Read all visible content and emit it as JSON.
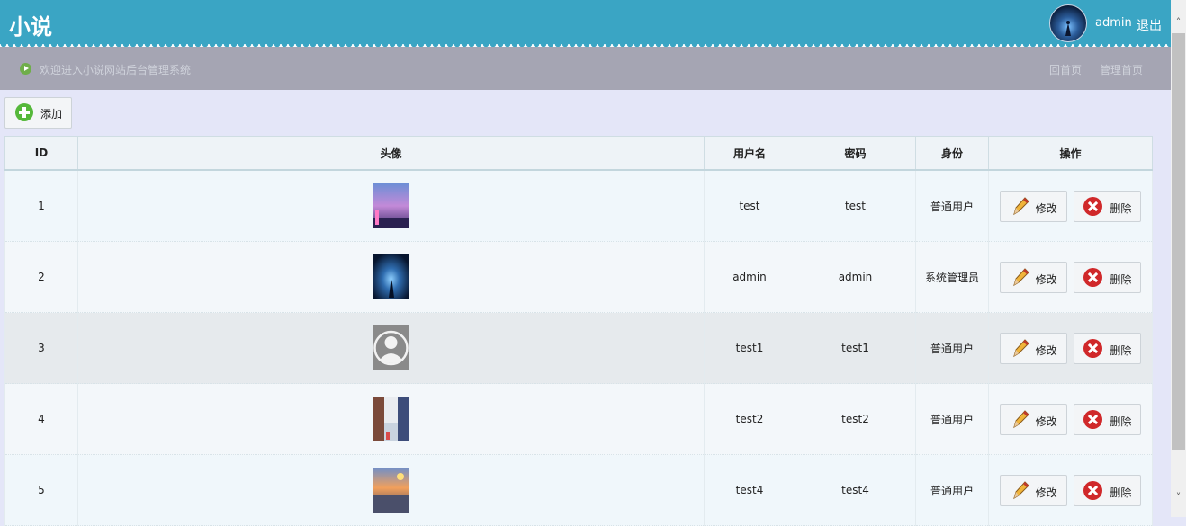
{
  "header": {
    "title": "小说",
    "user": "admin",
    "logout": "退出"
  },
  "subbar": {
    "welcome": "欢迎进入小说网站后台管理系统",
    "home_link": "回首页",
    "admin_home_link": "管理首页"
  },
  "toolbar": {
    "add_label": "添加",
    "add_icon": "plus-circle-icon"
  },
  "table": {
    "columns": [
      "ID",
      "头像",
      "用户名",
      "密码",
      "身份",
      "操作"
    ],
    "edit_label": "修改",
    "delete_label": "删除",
    "rows": [
      {
        "id": "1",
        "username": "test",
        "password": "test",
        "role": "普通用户"
      },
      {
        "id": "2",
        "username": "admin",
        "password": "admin",
        "role": "系统管理员"
      },
      {
        "id": "3",
        "username": "test1",
        "password": "test1",
        "role": "普通用户"
      },
      {
        "id": "4",
        "username": "test2",
        "password": "test2",
        "role": "普通用户"
      },
      {
        "id": "5",
        "username": "test4",
        "password": "test4",
        "role": "普通用户"
      }
    ]
  },
  "colors": {
    "header_bg": "#3aa5c4",
    "subbar_bg": "#a5a5b3",
    "page_bg": "#e4e6f8",
    "delete_red": "#d0282a",
    "add_green": "#55b83a"
  }
}
